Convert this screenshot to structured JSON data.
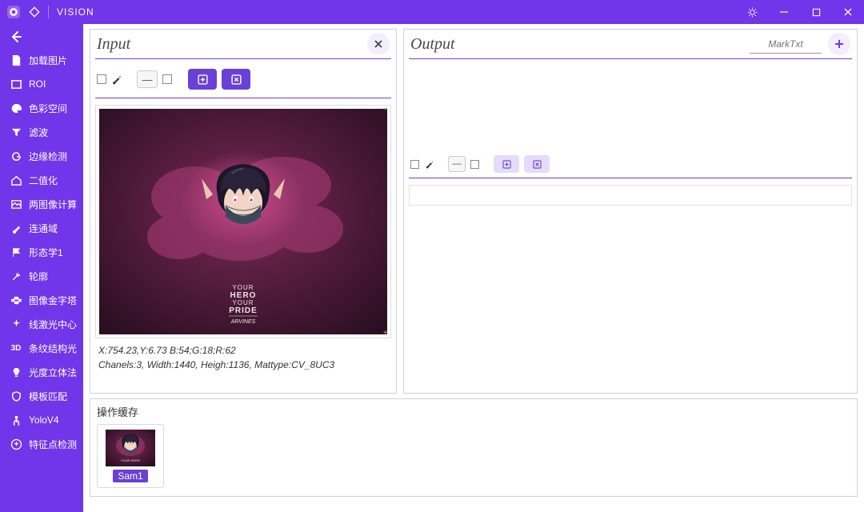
{
  "titlebar": {
    "title": "VISION"
  },
  "sidebar": {
    "items": [
      {
        "label": "加载图片",
        "icon": "image-file-icon"
      },
      {
        "label": "ROI",
        "icon": "rectangle-icon"
      },
      {
        "label": "色彩空间",
        "icon": "palette-icon"
      },
      {
        "label": "滤波",
        "icon": "filter-icon"
      },
      {
        "label": "边缘检测",
        "icon": "swirl-icon"
      },
      {
        "label": "二值化",
        "icon": "house-icon"
      },
      {
        "label": "两图像计算",
        "icon": "layers-icon"
      },
      {
        "label": "连通域",
        "icon": "brush-icon"
      },
      {
        "label": "形态学1",
        "icon": "flag-icon"
      },
      {
        "label": "轮廓",
        "icon": "wrench-icon"
      },
      {
        "label": "图像金字塔",
        "icon": "python-icon"
      },
      {
        "label": "线激光中心",
        "icon": "sparkle-icon"
      },
      {
        "label": "条纹结构光",
        "icon": "three-d-icon",
        "badge": "3D"
      },
      {
        "label": "光度立体法",
        "icon": "bulb-icon"
      },
      {
        "label": "模板匹配",
        "icon": "shield-icon"
      },
      {
        "label": "YoloV4",
        "icon": "person-icon"
      },
      {
        "label": "特征点检测",
        "icon": "star-circle-icon"
      }
    ]
  },
  "panels": {
    "input": {
      "title": "Input"
    },
    "output": {
      "title": "Output",
      "mark_placeholder": "MarkTxt"
    }
  },
  "info": {
    "line1": "X:754.23,Y:6.73    B:54;G:18;R:62",
    "line2": "Chanels:3, Width:1440, Heigh:1136, Mattype:CV_8UC3"
  },
  "cache": {
    "title": "操作缓存",
    "items": [
      {
        "label": "Sam1"
      }
    ]
  },
  "hero": {
    "line1": "YOUR",
    "line2": "HERO",
    "line3": "YOUR",
    "line4": "PRIDE",
    "brand": "ARVINES"
  }
}
